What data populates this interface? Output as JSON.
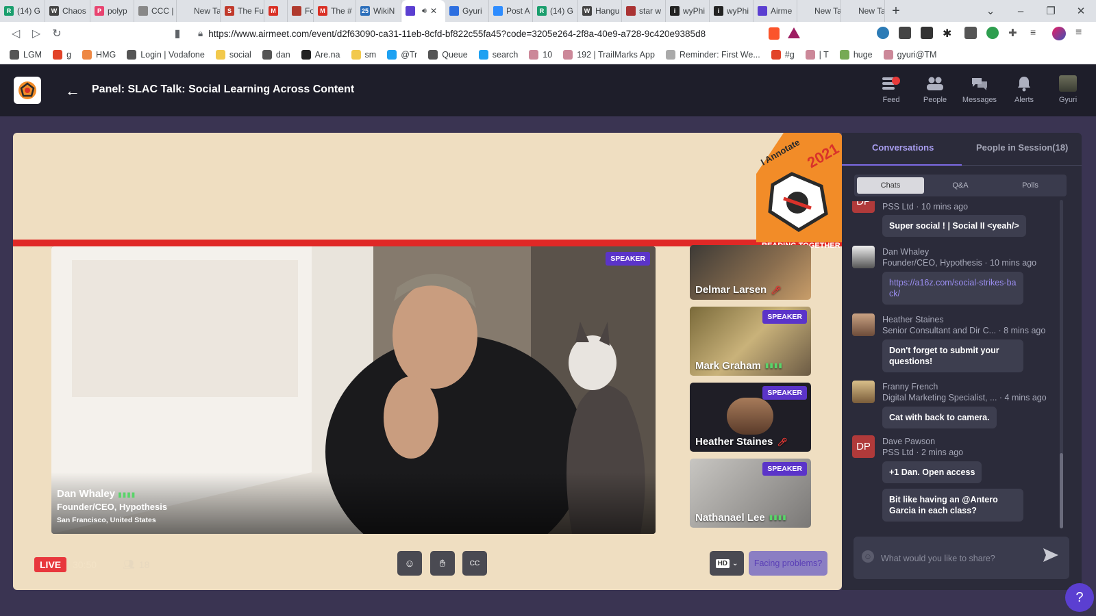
{
  "browser": {
    "tabs": [
      {
        "label": "(14) G",
        "fav": "#1a9e6d",
        "ch": "R"
      },
      {
        "label": "Chaos",
        "fav": "#444",
        "ch": "W"
      },
      {
        "label": "polyp",
        "fav": "#e84470",
        "ch": "P"
      },
      {
        "label": "CCC |",
        "fav": "#888",
        "ch": ""
      },
      {
        "label": "New Tab",
        "fav": "",
        "ch": ""
      },
      {
        "label": "The Fu",
        "fav": "#c0392b",
        "ch": "S"
      },
      {
        "label": "",
        "fav": "#d93025",
        "ch": "M"
      },
      {
        "label": "Fo",
        "fav": "#b03a2e",
        "ch": ""
      },
      {
        "label": "The #",
        "fav": "#d93025",
        "ch": "M"
      },
      {
        "label": "WikiN",
        "fav": "#2c6fbb",
        "ch": "25"
      },
      {
        "label": "",
        "fav": "#5b3fd1",
        "ch": "",
        "active": true
      },
      {
        "label": "Gyuri",
        "fav": "#2d6fe0",
        "ch": ""
      },
      {
        "label": "Post A",
        "fav": "#2d8cff",
        "ch": ""
      },
      {
        "label": "(14) G",
        "fav": "#1a9e6d",
        "ch": "R"
      },
      {
        "label": "Hangu",
        "fav": "#444",
        "ch": "W"
      },
      {
        "label": "star w",
        "fav": "#a33",
        "ch": ""
      },
      {
        "label": "wyPhi",
        "fav": "#222",
        "ch": "i"
      },
      {
        "label": "wyPhi",
        "fav": "#222",
        "ch": "i"
      },
      {
        "label": "Airme",
        "fav": "#5b3fd1",
        "ch": ""
      },
      {
        "label": "New Tab",
        "fav": "",
        "ch": ""
      },
      {
        "label": "New Tab",
        "fav": "",
        "ch": ""
      }
    ],
    "new_tab_glyph": "+",
    "url": "https://www.airmeet.com/event/d2f63090-ca31-11eb-8cfd-bf822c55fa45?code=3205e264-2f8a-40e9-a728-9c420e9385d8",
    "bookmarks": [
      {
        "label": "LGM",
        "color": "#555"
      },
      {
        "label": "g",
        "color": "#e24329"
      },
      {
        "label": "HMG",
        "color": "#e84"
      },
      {
        "label": "Login | Vodafone",
        "color": "#555"
      },
      {
        "label": "social",
        "color": "#f2c94c"
      },
      {
        "label": "dan",
        "color": "#555"
      },
      {
        "label": "Are.na",
        "color": "#222"
      },
      {
        "label": "sm",
        "color": "#f2c94c"
      },
      {
        "label": "@Tr",
        "color": "#1da1f2"
      },
      {
        "label": "Queue",
        "color": "#555"
      },
      {
        "label": "search",
        "color": "#1da1f2"
      },
      {
        "label": "10",
        "color": "#c89"
      },
      {
        "label": "192 | TrailMarks App",
        "color": "#c89"
      },
      {
        "label": "Reminder: First We...",
        "color": "#aaa"
      },
      {
        "label": "#g",
        "color": "#e24329"
      },
      {
        "label": "| T",
        "color": "#c89"
      },
      {
        "label": "huge",
        "color": "#7a5"
      },
      {
        "label": "gyuri@TM",
        "color": "#c89"
      }
    ]
  },
  "header": {
    "title": "Panel: SLAC Talk: Social Learning Across Content",
    "nav": [
      {
        "label": "Feed",
        "icon": "feed-icon"
      },
      {
        "label": "People",
        "icon": "people-icon"
      },
      {
        "label": "Messages",
        "icon": "messages-icon"
      },
      {
        "label": "Alerts",
        "icon": "bell-icon"
      },
      {
        "label": "Gyuri",
        "icon": "avatar"
      }
    ]
  },
  "stage": {
    "main": {
      "badge": "SPEAKER",
      "name": "Dan Whaley",
      "title": "Founder/CEO, Hypothesis",
      "location": "San Francisco, United States"
    },
    "tiles": [
      {
        "name": "Delmar Larsen",
        "badge": "",
        "mic": "off"
      },
      {
        "name": "Mark Graham",
        "badge": "SPEAKER",
        "mic": "on"
      },
      {
        "name": "Heather Staines",
        "badge": "SPEAKER",
        "mic": "off"
      },
      {
        "name": "Nathanael Lee",
        "badge": "SPEAKER",
        "mic": "on"
      }
    ],
    "live_label": "LIVE",
    "timer": "30:50",
    "attendee_count": "18",
    "hd_label": "HD",
    "facing_problems": "Facing problems?"
  },
  "panel": {
    "tabs": {
      "conversations": "Conversations",
      "people": "People in Session(18)"
    },
    "subtabs": {
      "chats": "Chats",
      "qa": "Q&A",
      "polls": "Polls"
    },
    "messages": [
      {
        "avatar": "DP",
        "sender": "PSS Ltd · 10 mins ago",
        "sender2": "",
        "text": "Super social ! | Social II <yeah/>"
      },
      {
        "avatar": "photo",
        "sender": "Dan Whaley",
        "sender2": "Founder/CEO, Hypothesis · 10 mins ago",
        "text": "https://a16z.com/social-strikes-back/"
      },
      {
        "avatar": "photo",
        "sender": "Heather Staines",
        "sender2": "Senior Consultant and Dir C... · 8 mins ago",
        "text": "Don't forget to submit your questions!"
      },
      {
        "avatar": "photo",
        "sender": "Franny French",
        "sender2": "Digital Marketing Specialist, ... · 4 mins ago",
        "text": "Cat with back to camera."
      },
      {
        "avatar": "DP",
        "sender": "Dave Pawson",
        "sender2": "PSS Ltd · 2 mins ago",
        "text": "+1 Dan. Open access"
      },
      {
        "avatar": "",
        "sender": "",
        "sender2": "",
        "text": "Bit like having an @Antero Garcia in each class?"
      }
    ],
    "input_placeholder": "What would you like to share?"
  },
  "help_glyph": "?",
  "colors": {
    "accent": "#5b3fd1",
    "live": "#e8373d",
    "stage_bg": "#efdec1",
    "panel_bg": "#2b2b3a"
  }
}
